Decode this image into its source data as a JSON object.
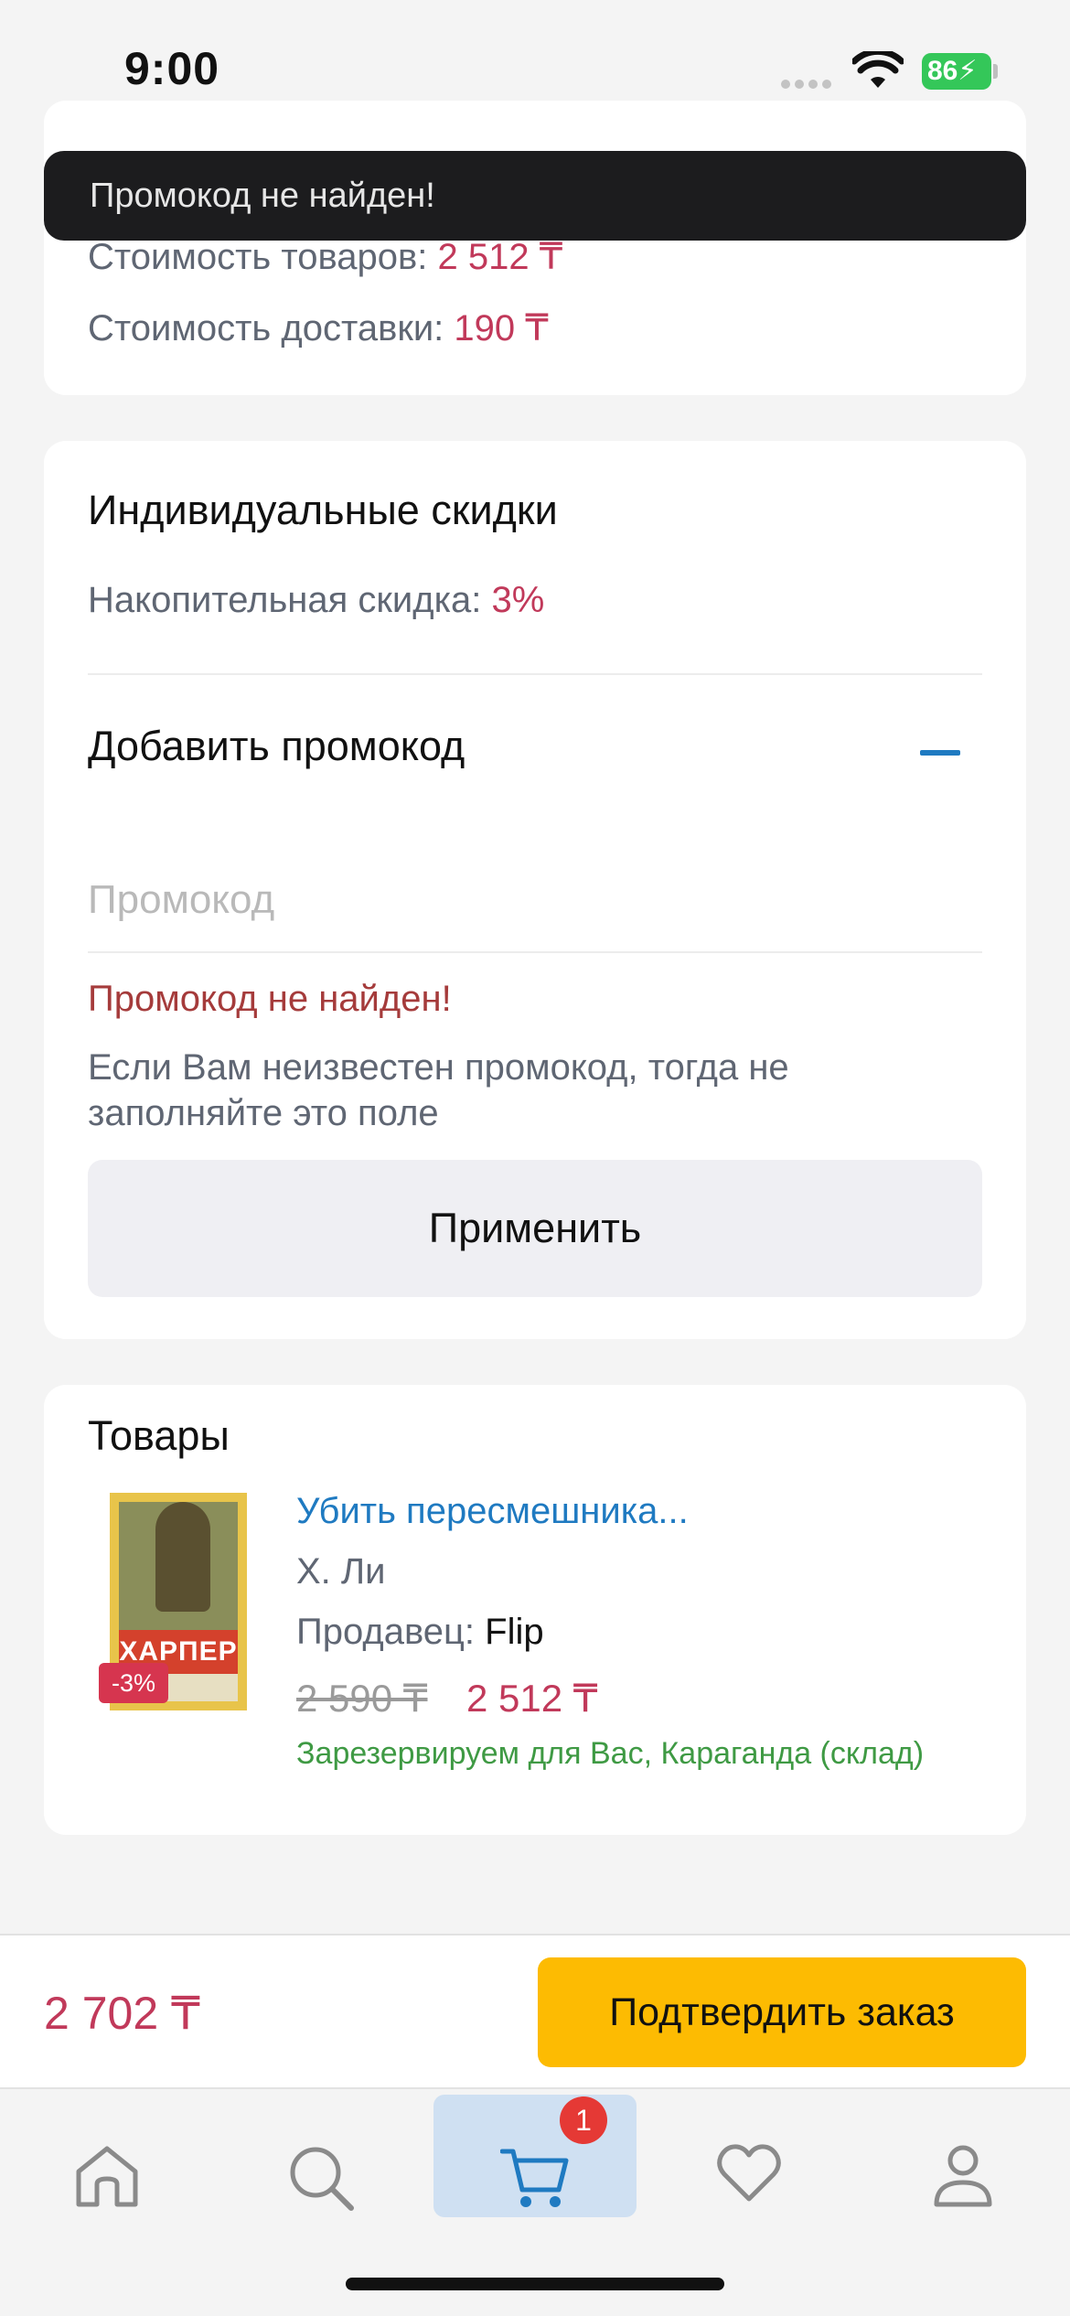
{
  "status_bar": {
    "time": "9:00",
    "battery": "86"
  },
  "toast": {
    "message": "Промокод  не найден!"
  },
  "summary": {
    "goods_label": "Стоимость товаров:",
    "goods_value": "2 512 ₸",
    "delivery_label": "Стоимость доставки:",
    "delivery_value": "190 ₸"
  },
  "discounts": {
    "title": "Индивидуальные скидки",
    "cumulative_label": "Накопительная скидка:",
    "cumulative_value": "3%",
    "promo_title": "Добавить промокод",
    "promo_placeholder": "Промокод",
    "promo_value": "",
    "error": "Промокод  не найден!",
    "hint": "Если Вам неизвестен промокод, тогда не заполняйте это поле",
    "apply_label": "Применить"
  },
  "goods": {
    "title": "Товары",
    "items": [
      {
        "cover_text": "ХАРПЕР ЛИ",
        "discount_badge": "-3%",
        "title": "Убить пересмешника...",
        "author": "Х. Ли",
        "seller_label": "Продавец:",
        "seller_name": "Flip",
        "old_price": "2 590 ₸",
        "new_price": "2 512 ₸",
        "stock_note": "Зарезервируем для Вас, Караганда (склад)"
      }
    ]
  },
  "checkout": {
    "total": "2 702 ₸",
    "confirm_label": "Подтвердить заказ"
  },
  "tab_bar": {
    "items": [
      {
        "icon": "home-icon"
      },
      {
        "icon": "search-icon"
      },
      {
        "icon": "cart-icon",
        "active": true,
        "badge": "1"
      },
      {
        "icon": "heart-icon"
      },
      {
        "icon": "profile-icon"
      }
    ]
  },
  "colors": {
    "accent_price": "#c1395a",
    "link_blue": "#1f7ac1",
    "confirm_yellow": "#fdbb02",
    "stock_green": "#3f9a44",
    "error_red": "#a53b3b",
    "active_tab": "#cfe0f2",
    "badge_red": "#e53935"
  }
}
